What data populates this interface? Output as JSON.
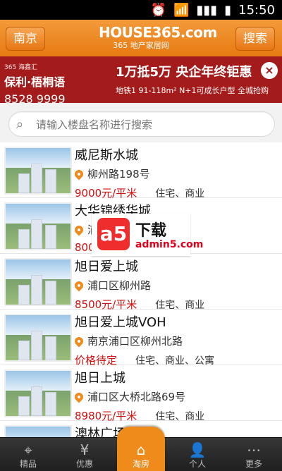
{
  "status": {
    "time": "15:50",
    "icons": [
      "alarm-icon",
      "wifi-icon",
      "signal-icon",
      "battery-icon"
    ]
  },
  "header": {
    "city_button": "南京",
    "logo_brand": "HOUSE365.com",
    "logo_sub": "365 地产家居网",
    "search_button": "搜索"
  },
  "banner": {
    "left_tiny": "365 海鑫汇",
    "left_brand": "保利·梧桐语",
    "phone": "8528 9999",
    "headline": "1万抵5万 央企年终钜惠",
    "subline": "地铁1 91-118m² N+1可成长户型 全城抢购",
    "close": "×"
  },
  "search": {
    "placeholder": "请输入楼盘名称进行搜索",
    "icon": "search-icon"
  },
  "listings": [
    {
      "title": "威尼斯水城",
      "address": "柳州路198号",
      "price": "9000元/平米",
      "tags": "住宅、商业"
    },
    {
      "title": "大华锦绣华城",
      "address": "浦",
      "price": "800",
      "tags": ""
    },
    {
      "title": "旭日爱上城",
      "address": "浦口区柳州路",
      "price": "8500元/平米",
      "tags": "住宅、商业"
    },
    {
      "title": "旭日爱上城VOH",
      "address": "南京浦口区柳州北路",
      "price": "价格待定",
      "tags": "住宅、商业、公寓"
    },
    {
      "title": "旭日上城",
      "address": "浦口区大桥北路69号",
      "price": "8980元/平米",
      "tags": "住宅、商业"
    },
    {
      "title": "澳林广场"
    }
  ],
  "watermark": {
    "mark": "a5",
    "title": "下载",
    "url": "admin5.com"
  },
  "tabbar": {
    "tabs": [
      {
        "label": "精品",
        "icon": "target-icon"
      },
      {
        "label": "优惠",
        "icon": "money-bag-icon"
      },
      {
        "label": "淘房",
        "icon": "house-search-icon",
        "active": true
      },
      {
        "label": "个人",
        "icon": "person-icon"
      },
      {
        "label": "更多",
        "icon": "more-icon"
      }
    ]
  }
}
